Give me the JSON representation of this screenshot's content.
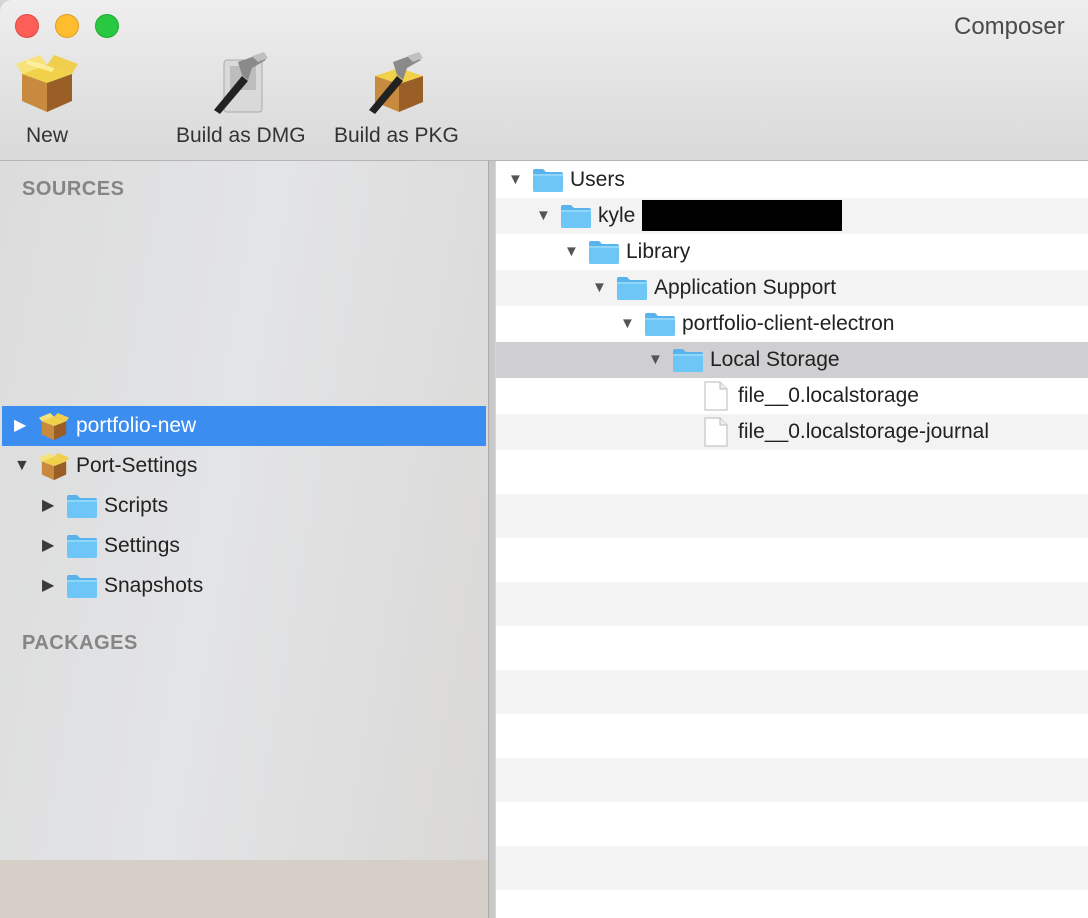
{
  "window": {
    "title": "Composer"
  },
  "toolbar": {
    "new_label": "New",
    "build_dmg_label": "Build as DMG",
    "build_pkg_label": "Build as PKG"
  },
  "sidebar": {
    "sources_header": "SOURCES",
    "packages_header": "PACKAGES",
    "items": [
      {
        "label": "portfolio-new",
        "selected": true,
        "expanded": false
      },
      {
        "label": "Port-Settings",
        "selected": false,
        "expanded": true
      },
      {
        "label": "Scripts",
        "expanded": false
      },
      {
        "label": "Settings",
        "expanded": false
      },
      {
        "label": "Snapshots",
        "expanded": false
      }
    ]
  },
  "tree": {
    "rows": [
      {
        "label": "Users",
        "type": "folder",
        "expanded": true
      },
      {
        "label": "kyle",
        "type": "folder",
        "expanded": true
      },
      {
        "label": "Library",
        "type": "folder",
        "expanded": true
      },
      {
        "label": "Application Support",
        "type": "folder",
        "expanded": true
      },
      {
        "label": "portfolio-client-electron",
        "type": "folder",
        "expanded": true
      },
      {
        "label": "Local Storage",
        "type": "folder",
        "expanded": true,
        "selected": true
      },
      {
        "label": "file__0.localstorage",
        "type": "file"
      },
      {
        "label": "file__0.localstorage-journal",
        "type": "file"
      }
    ]
  },
  "colors": {
    "selection_blue": "#3b8df0",
    "tree_selection_gray": "#cfcfd1",
    "folder_blue": "#6ec6f6"
  },
  "icons": {
    "new": "package-box-icon",
    "build_dmg": "hammer-disk-icon",
    "build_pkg": "hammer-box-icon"
  }
}
